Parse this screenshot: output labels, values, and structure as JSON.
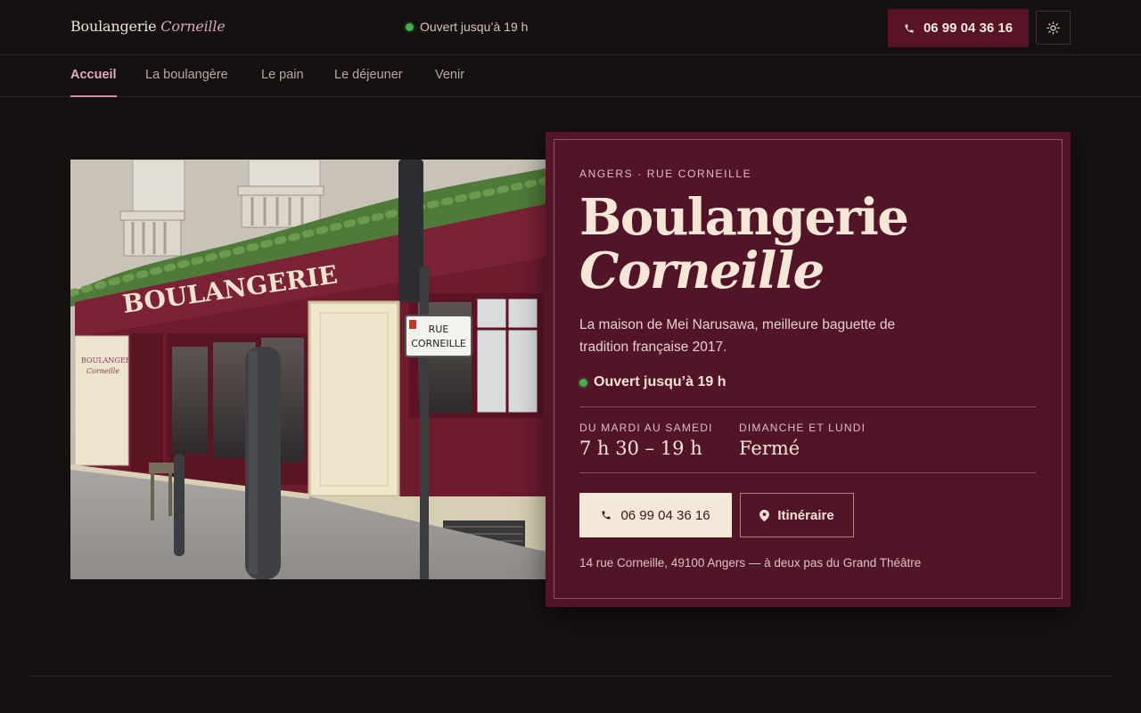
{
  "header": {
    "brand_main": "Boulangerie",
    "brand_accent": "Corneille",
    "status": "Ouvert jusqu’à 19 h",
    "phone_label": "06 99 04 36 16",
    "theme_icon": "sun-icon"
  },
  "nav": {
    "items": [
      {
        "label": "Accueil",
        "active": true
      },
      {
        "label": "La boulangère",
        "active": false
      },
      {
        "label": "Le pain",
        "active": false
      },
      {
        "label": "Le déjeuner",
        "active": false
      },
      {
        "label": "Venir",
        "active": false
      }
    ]
  },
  "hero": {
    "photo": {
      "sign_text": "BOULANGERIE",
      "street_sign_line1": "RUE",
      "street_sign_line2": "CORNEILLE",
      "window_text_1": "BOULANGERIE",
      "window_text_2": "Corneille"
    },
    "card": {
      "eyebrow": "ANGERS · RUE CORNEILLE",
      "title_main": "Boulangerie",
      "title_italic": "Corneille",
      "description": "La maison de Mei Narusawa, meilleure baguette de tradition française 2017.",
      "status": "Ouvert jusqu’à 19 h",
      "hours": [
        {
          "label": "DU MARDI AU SAMEDI",
          "value": "7 h 30 – 19 h"
        },
        {
          "label": "DIMANCHE ET LUNDI",
          "value": "Fermé"
        }
      ],
      "call_label": "06 99 04 36 16",
      "route_label": "Itinéraire",
      "address": "14 rue Corneille, 49100 Angers — à deux pas du Grand Théâtre"
    }
  },
  "colors": {
    "background": "#161111",
    "accent": "#521528",
    "accent_pink": "#e2a9c0",
    "open_green": "#3fb14f",
    "cream": "#f6e8d8"
  }
}
